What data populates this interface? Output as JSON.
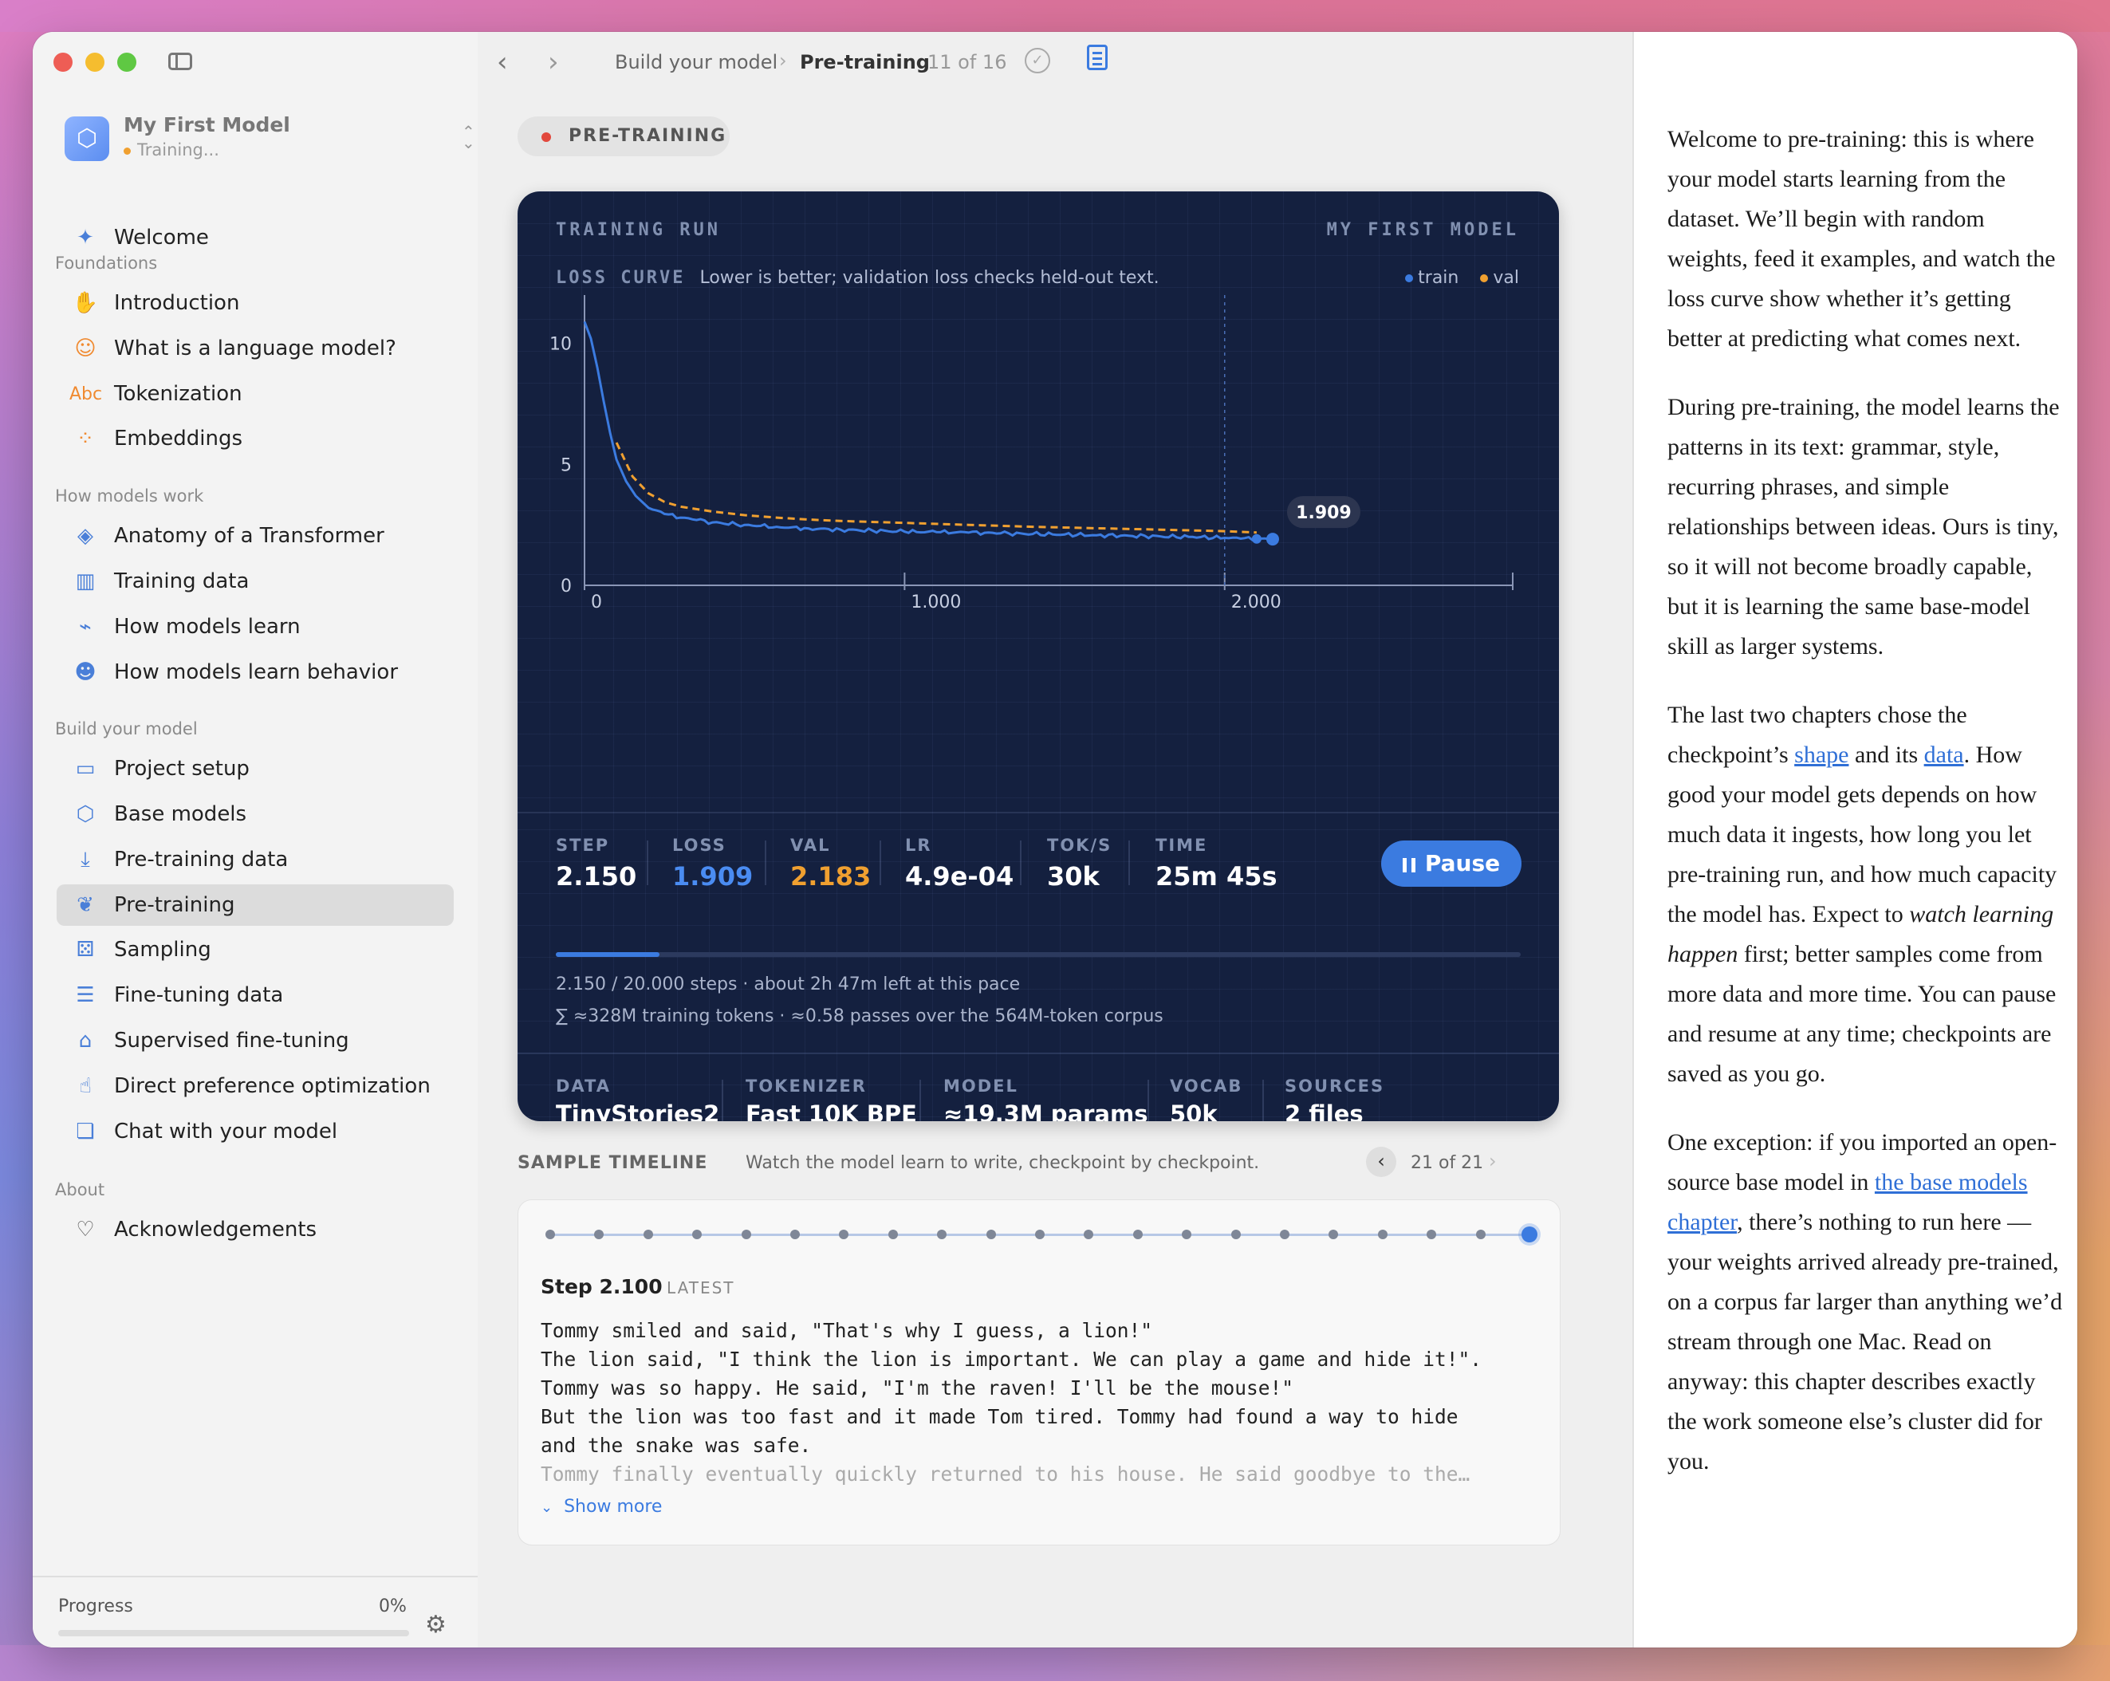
{
  "sidebar": {
    "model": {
      "name": "My First Model",
      "status": "Training..."
    },
    "welcome": "Welcome",
    "sections": {
      "foundations": "Foundations",
      "how_models_work": "How models work",
      "build": "Build your model",
      "about": "About"
    },
    "items": {
      "introduction": "Introduction",
      "what_is_lm": "What is a language model?",
      "tokenization": "Tokenization",
      "embeddings": "Embeddings",
      "anatomy": "Anatomy of a Transformer",
      "training_data": "Training data",
      "how_models_learn": "How models learn",
      "how_models_learn_behavior": "How models learn behavior",
      "project_setup": "Project setup",
      "base_models": "Base models",
      "pretraining_data": "Pre-training data",
      "pretraining": "Pre-training",
      "sampling": "Sampling",
      "finetuning_data": "Fine-tuning data",
      "sft": "Supervised fine-tuning",
      "dpo": "Direct preference optimization",
      "chat": "Chat with your model",
      "acknowledgements": "Acknowledgements"
    },
    "tokenization_glyph": "Abc",
    "progress": {
      "label": "Progress",
      "value_text": "0%",
      "value": 0
    }
  },
  "toolbar": {
    "crumb_parent": "Build your model",
    "crumb_current": "Pre-training",
    "count": "11 of 16"
  },
  "status_pill": "PRE-TRAINING",
  "panel": {
    "title": "TRAINING RUN",
    "model_label": "MY FIRST MODEL",
    "loss_label": "LOSS CURVE",
    "loss_desc": "Lower is better; validation loss checks held-out text.",
    "legend": {
      "train": "train",
      "val": "val"
    },
    "stats": {
      "step": {
        "label": "STEP",
        "value": "2.150"
      },
      "loss": {
        "label": "LOSS",
        "value": "1.909"
      },
      "val": {
        "label": "VAL",
        "value": "2.183"
      },
      "lr": {
        "label": "LR",
        "value": "4.9e-04"
      },
      "tok": {
        "label": "TOK/S",
        "value": "30k"
      },
      "time": {
        "label": "TIME",
        "value": "25m 45s"
      }
    },
    "pause_label": "Pause",
    "run_progress": 0.1075,
    "run_line1": "2.150 / 20.000 steps · about 2h 47m left at this pace",
    "run_line2": "∑  ≈328M training tokens · ≈0.58 passes over the 564M-token corpus",
    "specs": {
      "data": {
        "label": "DATA",
        "value": "TinyStories2"
      },
      "tokenizer": {
        "label": "TOKENIZER",
        "value": "Fast 10K BPE"
      },
      "model": {
        "label": "MODEL",
        "value": "≈19.3M params"
      },
      "vocab": {
        "label": "VOCAB",
        "value": "50k"
      },
      "sources": {
        "label": "SOURCES",
        "value": "2 files"
      }
    }
  },
  "chart_data": {
    "type": "line",
    "title": "",
    "xlabel": "",
    "ylabel": "",
    "xlim": [
      0,
      2900
    ],
    "ylim": [
      0,
      12
    ],
    "x_ticks": [
      "0",
      "1.000",
      "2.000"
    ],
    "y_ticks": [
      "0",
      "5",
      "10"
    ],
    "marker_label": "1.909",
    "colors": {
      "train": "#3b7be0",
      "val": "#f0a030"
    },
    "series": [
      {
        "name": "train",
        "x": [
          0,
          20,
          40,
          60,
          80,
          100,
          130,
          160,
          200,
          250,
          300,
          350,
          400,
          500,
          600,
          700,
          800,
          900,
          1000,
          1100,
          1200,
          1300,
          1400,
          1500,
          1600,
          1700,
          1800,
          1900,
          2000,
          2050,
          2100,
          2150
        ],
        "y": [
          10.9,
          10.2,
          9.0,
          7.6,
          6.3,
          5.2,
          4.3,
          3.7,
          3.2,
          2.95,
          2.8,
          2.7,
          2.6,
          2.5,
          2.42,
          2.35,
          2.3,
          2.26,
          2.22,
          2.2,
          2.18,
          2.15,
          2.12,
          2.1,
          2.07,
          2.05,
          2.02,
          2.0,
          1.96,
          1.93,
          1.92,
          1.909
        ]
      },
      {
        "name": "val",
        "x": [
          100,
          150,
          200,
          250,
          300,
          400,
          500,
          600,
          700,
          800,
          1000,
          1200,
          1400,
          1600,
          1800,
          2000,
          2100
        ],
        "y": [
          5.9,
          4.5,
          3.8,
          3.45,
          3.25,
          3.05,
          2.9,
          2.8,
          2.72,
          2.66,
          2.58,
          2.5,
          2.42,
          2.36,
          2.3,
          2.24,
          2.183
        ]
      }
    ]
  },
  "timeline": {
    "title": "SAMPLE TIMELINE",
    "subtitle": "Watch the model learn to write, checkpoint by checkpoint.",
    "count": "21 of 21",
    "total": 21,
    "current": 21,
    "step_title": "Step 2.100",
    "step_badge": "LATEST",
    "text_lines": [
      "Tommy smiled and said, \"That's why I guess, a lion!\"",
      "The lion said, \"I think the lion is important. We can play a game and hide it!\".",
      "Tommy was so happy. He said, \"I'm the raven! I'll be the mouse!\"",
      "But the lion was too fast and it made Tom tired. Tommy had found a way to hide",
      "and the snake was safe."
    ],
    "faded_line": "Tommy finally eventually quickly returned to his house. He said goodbye to the…",
    "show_more": "Show more"
  },
  "article": {
    "p1": "Welcome to pre-training: this is where your model starts learning from the dataset. We’ll begin with random weights, feed it examples, and watch the loss curve show whether it’s getting better at predicting what comes next.",
    "p2": "During pre-training, the model learns the patterns in its text: grammar, style, recurring phrases, and simple relationships between ideas. Ours is tiny, so it will not become broadly capable, but it is learning the same base-model skill as larger systems.",
    "p3_a": "The last two chapters chose the checkpoint’s ",
    "p3_link1": "shape",
    "p3_b": " and its ",
    "p3_link2": "data",
    "p3_c": ". How good your model gets depends on how much data it ingests, how long you let pre-training run, and how much capacity the model has. Expect to ",
    "p3_em": "watch learning happen",
    "p3_d": " first; better samples come from more data and more time. You can pause and resume at any time; checkpoints are saved as you go.",
    "p4_a": "One exception: if you imported an open-source base model in ",
    "p4_link": "the base models chapter",
    "p4_b": ", there’s nothing to run here — your weights arrived already pre-trained, on a corpus far larger than anything we’d stream through one Mac. Read on anyway: this chapter describes exactly the work someone else’s cluster did for you."
  }
}
